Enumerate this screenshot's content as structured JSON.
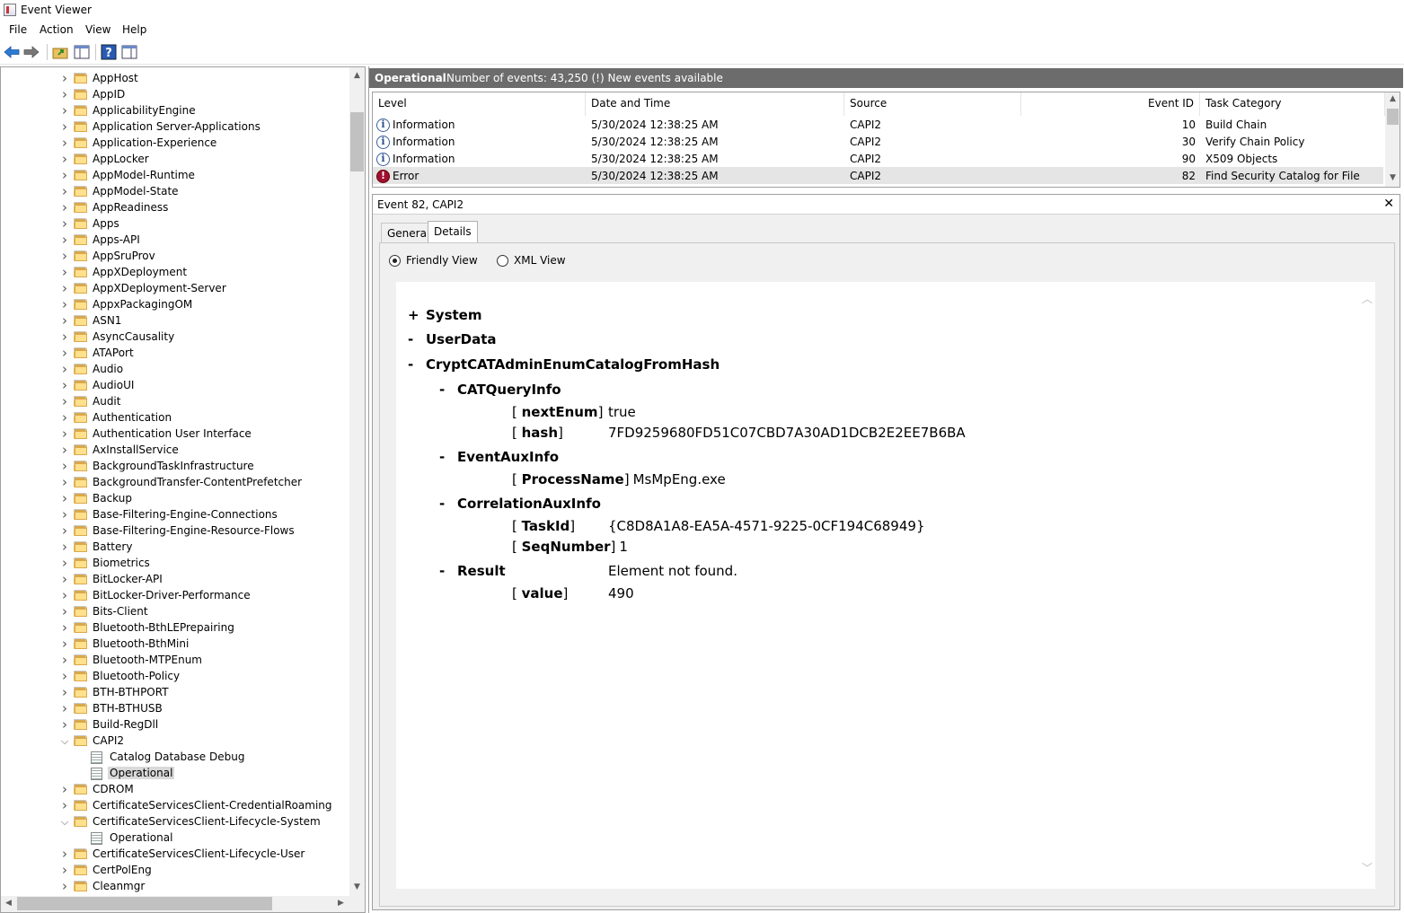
{
  "window": {
    "title": "Event Viewer"
  },
  "menu": [
    "File",
    "Action",
    "View",
    "Help"
  ],
  "tree": [
    {
      "label": "AppHost",
      "kind": "folder",
      "depth": 0,
      "exp": "collapsed"
    },
    {
      "label": "AppID",
      "kind": "folder",
      "depth": 0,
      "exp": "collapsed"
    },
    {
      "label": "ApplicabilityEngine",
      "kind": "folder",
      "depth": 0,
      "exp": "collapsed"
    },
    {
      "label": "Application Server-Applications",
      "kind": "folder",
      "depth": 0,
      "exp": "collapsed"
    },
    {
      "label": "Application-Experience",
      "kind": "folder",
      "depth": 0,
      "exp": "collapsed"
    },
    {
      "label": "AppLocker",
      "kind": "folder",
      "depth": 0,
      "exp": "collapsed"
    },
    {
      "label": "AppModel-Runtime",
      "kind": "folder",
      "depth": 0,
      "exp": "collapsed"
    },
    {
      "label": "AppModel-State",
      "kind": "folder",
      "depth": 0,
      "exp": "collapsed"
    },
    {
      "label": "AppReadiness",
      "kind": "folder",
      "depth": 0,
      "exp": "collapsed"
    },
    {
      "label": "Apps",
      "kind": "folder",
      "depth": 0,
      "exp": "collapsed"
    },
    {
      "label": "Apps-API",
      "kind": "folder",
      "depth": 0,
      "exp": "collapsed"
    },
    {
      "label": "AppSruProv",
      "kind": "folder",
      "depth": 0,
      "exp": "collapsed"
    },
    {
      "label": "AppXDeployment",
      "kind": "folder",
      "depth": 0,
      "exp": "collapsed"
    },
    {
      "label": "AppXDeployment-Server",
      "kind": "folder",
      "depth": 0,
      "exp": "collapsed"
    },
    {
      "label": "AppxPackagingOM",
      "kind": "folder",
      "depth": 0,
      "exp": "collapsed"
    },
    {
      "label": "ASN1",
      "kind": "folder",
      "depth": 0,
      "exp": "collapsed"
    },
    {
      "label": "AsyncCausality",
      "kind": "folder",
      "depth": 0,
      "exp": "collapsed"
    },
    {
      "label": "ATAPort",
      "kind": "folder",
      "depth": 0,
      "exp": "collapsed"
    },
    {
      "label": "Audio",
      "kind": "folder",
      "depth": 0,
      "exp": "collapsed"
    },
    {
      "label": "AudioUI",
      "kind": "folder",
      "depth": 0,
      "exp": "collapsed"
    },
    {
      "label": "Audit",
      "kind": "folder",
      "depth": 0,
      "exp": "collapsed"
    },
    {
      "label": "Authentication",
      "kind": "folder",
      "depth": 0,
      "exp": "collapsed"
    },
    {
      "label": "Authentication User Interface",
      "kind": "folder",
      "depth": 0,
      "exp": "collapsed"
    },
    {
      "label": "AxInstallService",
      "kind": "folder",
      "depth": 0,
      "exp": "collapsed"
    },
    {
      "label": "BackgroundTaskInfrastructure",
      "kind": "folder",
      "depth": 0,
      "exp": "collapsed"
    },
    {
      "label": "BackgroundTransfer-ContentPrefetcher",
      "kind": "folder",
      "depth": 0,
      "exp": "collapsed"
    },
    {
      "label": "Backup",
      "kind": "folder",
      "depth": 0,
      "exp": "collapsed"
    },
    {
      "label": "Base-Filtering-Engine-Connections",
      "kind": "folder",
      "depth": 0,
      "exp": "collapsed"
    },
    {
      "label": "Base-Filtering-Engine-Resource-Flows",
      "kind": "folder",
      "depth": 0,
      "exp": "collapsed"
    },
    {
      "label": "Battery",
      "kind": "folder",
      "depth": 0,
      "exp": "collapsed"
    },
    {
      "label": "Biometrics",
      "kind": "folder",
      "depth": 0,
      "exp": "collapsed"
    },
    {
      "label": "BitLocker-API",
      "kind": "folder",
      "depth": 0,
      "exp": "collapsed"
    },
    {
      "label": "BitLocker-Driver-Performance",
      "kind": "folder",
      "depth": 0,
      "exp": "collapsed"
    },
    {
      "label": "Bits-Client",
      "kind": "folder",
      "depth": 0,
      "exp": "collapsed"
    },
    {
      "label": "Bluetooth-BthLEPrepairing",
      "kind": "folder",
      "depth": 0,
      "exp": "collapsed"
    },
    {
      "label": "Bluetooth-BthMini",
      "kind": "folder",
      "depth": 0,
      "exp": "collapsed"
    },
    {
      "label": "Bluetooth-MTPEnum",
      "kind": "folder",
      "depth": 0,
      "exp": "collapsed"
    },
    {
      "label": "Bluetooth-Policy",
      "kind": "folder",
      "depth": 0,
      "exp": "collapsed"
    },
    {
      "label": "BTH-BTHPORT",
      "kind": "folder",
      "depth": 0,
      "exp": "collapsed"
    },
    {
      "label": "BTH-BTHUSB",
      "kind": "folder",
      "depth": 0,
      "exp": "collapsed"
    },
    {
      "label": "Build-RegDll",
      "kind": "folder",
      "depth": 0,
      "exp": "collapsed"
    },
    {
      "label": "CAPI2",
      "kind": "folder",
      "depth": 0,
      "exp": "expanded"
    },
    {
      "label": "Catalog Database Debug",
      "kind": "debuglog",
      "depth": 1,
      "exp": "none"
    },
    {
      "label": "Operational",
      "kind": "log",
      "depth": 1,
      "exp": "none",
      "selected": true
    },
    {
      "label": "CDROM",
      "kind": "folder",
      "depth": 0,
      "exp": "collapsed"
    },
    {
      "label": "CertificateServicesClient-CredentialRoaming",
      "kind": "folder",
      "depth": 0,
      "exp": "collapsed"
    },
    {
      "label": "CertificateServicesClient-Lifecycle-System",
      "kind": "folder",
      "depth": 0,
      "exp": "expanded"
    },
    {
      "label": "Operational",
      "kind": "log",
      "depth": 1,
      "exp": "none"
    },
    {
      "label": "CertificateServicesClient-Lifecycle-User",
      "kind": "folder",
      "depth": 0,
      "exp": "collapsed"
    },
    {
      "label": "CertPolEng",
      "kind": "folder",
      "depth": 0,
      "exp": "collapsed"
    },
    {
      "label": "Cleanmgr",
      "kind": "folder",
      "depth": 0,
      "exp": "collapsed"
    }
  ],
  "log_header": {
    "name": "Operational",
    "count_text": "Number of events: 43,250 (!) New events available"
  },
  "event_columns": [
    "Level",
    "Date and Time",
    "Source",
    "Event ID",
    "Task Category"
  ],
  "events": [
    {
      "level": "Information",
      "datetime": "5/30/2024 12:38:25 AM",
      "source": "CAPI2",
      "event_id": "10",
      "task": "Build Chain",
      "icon": "info-icon"
    },
    {
      "level": "Information",
      "datetime": "5/30/2024 12:38:25 AM",
      "source": "CAPI2",
      "event_id": "30",
      "task": "Verify Chain Policy",
      "icon": "info-icon"
    },
    {
      "level": "Information",
      "datetime": "5/30/2024 12:38:25 AM",
      "source": "CAPI2",
      "event_id": "90",
      "task": "X509 Objects",
      "icon": "info-icon"
    },
    {
      "level": "Error",
      "datetime": "5/30/2024 12:38:25 AM",
      "source": "CAPI2",
      "event_id": "82",
      "task": "Find Security Catalog for File",
      "icon": "error-icon",
      "selected": true
    }
  ],
  "detail": {
    "title": "Event 82, CAPI2",
    "close_glyph": "✕",
    "tabs": [
      "General",
      "Details"
    ],
    "active_tab": "Details",
    "radio_friendly": "Friendly View",
    "radio_xml": "XML View",
    "tree": [
      {
        "toggle": "+",
        "name": "System",
        "indent": 0
      },
      {
        "toggle": "-",
        "name": "UserData",
        "indent": 0
      },
      {
        "toggle": "-",
        "name": "CryptCATAdminEnumCatalogFromHash",
        "indent": 1
      },
      {
        "toggle": "-",
        "name": "CATQueryInfo",
        "indent": 2
      },
      {
        "attr": "nextEnum",
        "value": "true",
        "indent": 3
      },
      {
        "attr": "hash",
        "value": "7FD9259680FD51C07CBD7A30AD1DCB2E2EE7B6BA",
        "indent": 3
      },
      {
        "toggle": "-",
        "name": "EventAuxInfo",
        "indent": 2
      },
      {
        "attr": "ProcessName",
        "value": "MsMpEng.exe",
        "indent": 3,
        "inline": true
      },
      {
        "toggle": "-",
        "name": "CorrelationAuxInfo",
        "indent": 2
      },
      {
        "attr": "TaskId",
        "value": "{C8D8A1A8-EA5A-4571-9225-0CF194C68949}",
        "indent": 3
      },
      {
        "attr": "SeqNumber",
        "value": "1",
        "indent": 3,
        "inline": true
      },
      {
        "toggle": "-",
        "name": "Result",
        "value": "Element not found.",
        "indent": 2
      },
      {
        "attr": "value",
        "value": "490",
        "indent": 3
      }
    ]
  }
}
